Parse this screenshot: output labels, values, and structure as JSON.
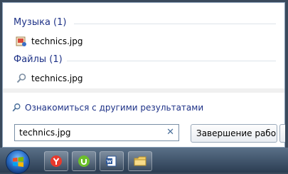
{
  "results": {
    "music_header": "Музыка (1)",
    "music_item": "technics.jpg",
    "files_header": "Файлы (1)",
    "files_item": "technics.jpg",
    "more_results": "Ознакомиться с другими результатами"
  },
  "search": {
    "value": "technics.jpg",
    "clear_label": "✕"
  },
  "shutdown": {
    "label": "Завершение рабо..."
  },
  "taskbar": {
    "apps": [
      "yandex-browser-icon",
      "utorrent-icon",
      "word-icon",
      "explorer-folder-icon"
    ]
  },
  "colors": {
    "header_text": "#1e3287",
    "taskbar": "#2b3d52"
  }
}
